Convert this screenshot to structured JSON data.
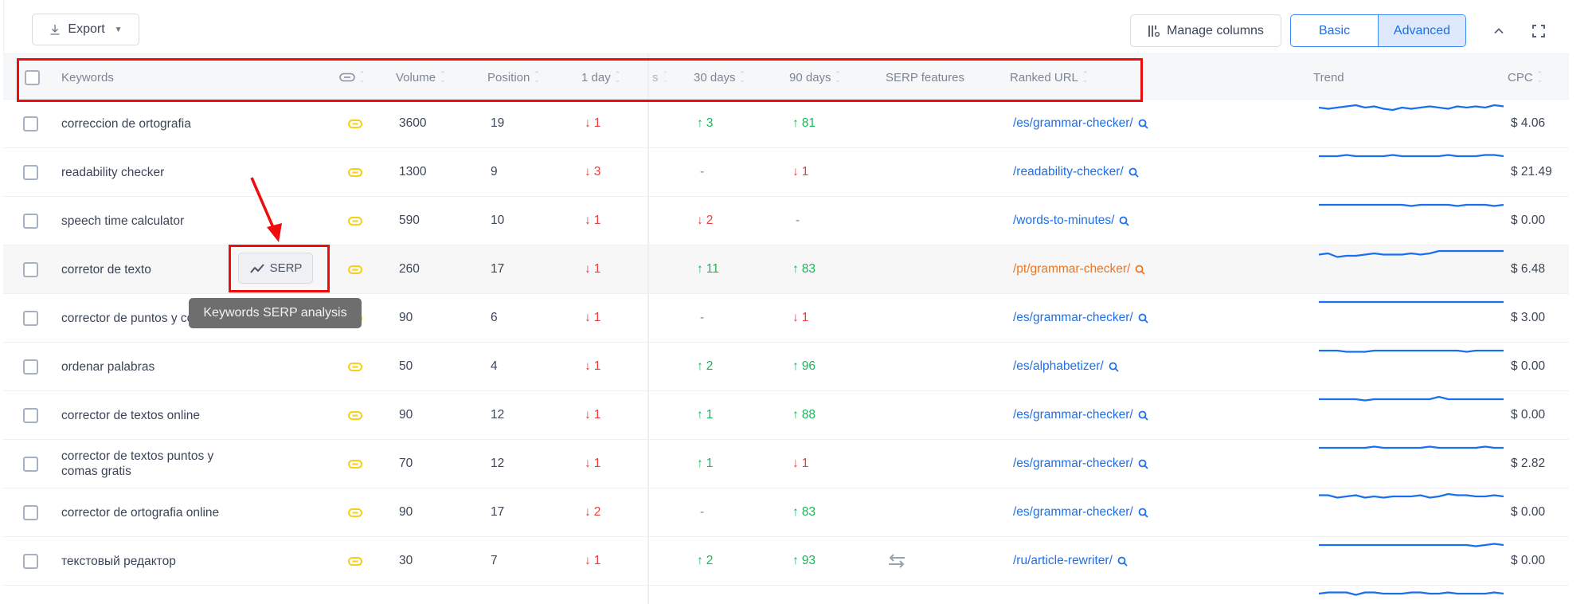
{
  "toolbar": {
    "export_label": "Export",
    "manage_columns_label": "Manage columns",
    "view_modes": [
      {
        "label": "Basic",
        "active": false
      },
      {
        "label": "Advanced",
        "active": true
      }
    ]
  },
  "table": {
    "headers": {
      "keywords": "Keywords",
      "volume": "Volume",
      "position": "Position",
      "day1": "1 day",
      "day7_partial": "s",
      "day30": "30 days",
      "day90": "90 days",
      "serp_features": "SERP features",
      "ranked_url": "Ranked URL",
      "trend": "Trend",
      "cpc": "CPC"
    },
    "rows": [
      {
        "keyword": "correccion de ortografia",
        "volume": "3600",
        "position": "19",
        "d1": {
          "dir": "down",
          "val": "1"
        },
        "d30": {
          "dir": "up",
          "val": "3"
        },
        "d90": {
          "dir": "up",
          "val": "81"
        },
        "serp": "",
        "url": "/es/grammar-checker/",
        "cpc": "$ 4.06",
        "trend": [
          5,
          4,
          5,
          6,
          7,
          5,
          6,
          4,
          3,
          5,
          4,
          5,
          6,
          5,
          4,
          6,
          5,
          6,
          5,
          7,
          6
        ]
      },
      {
        "keyword": "readability checker",
        "volume": "1300",
        "position": "9",
        "d1": {
          "dir": "down",
          "val": "3"
        },
        "d30": {
          "dir": "none",
          "val": "-"
        },
        "d90": {
          "dir": "down",
          "val": "1"
        },
        "serp": "",
        "url": "/readability-checker/",
        "cpc": "$ 21.49",
        "trend": [
          5,
          5,
          5,
          6,
          5,
          5,
          5,
          5,
          6,
          5,
          5,
          5,
          5,
          5,
          6,
          5,
          5,
          5,
          6,
          6,
          5
        ]
      },
      {
        "keyword": "speech time calculator",
        "volume": "590",
        "position": "10",
        "d1": {
          "dir": "down",
          "val": "1"
        },
        "d30": {
          "dir": "down",
          "val": "2"
        },
        "d90": {
          "dir": "none",
          "val": "-"
        },
        "serp": "",
        "url": "/words-to-minutes/",
        "cpc": "$ 0.00",
        "trend": [
          5,
          5,
          5,
          5,
          5,
          5,
          5,
          5,
          5,
          5,
          4,
          5,
          5,
          5,
          5,
          4,
          5,
          5,
          5,
          4,
          5
        ]
      },
      {
        "keyword": "corretor de texto",
        "volume": "260",
        "position": "17",
        "d1": {
          "dir": "down",
          "val": "1"
        },
        "d30": {
          "dir": "up",
          "val": "11"
        },
        "d90": {
          "dir": "up",
          "val": "83"
        },
        "serp": "",
        "url": "/pt/grammar-checker/",
        "url_highlight": true,
        "cpc": "$ 6.48",
        "trend": [
          4,
          5,
          2,
          3,
          3,
          4,
          5,
          4,
          4,
          4,
          5,
          4,
          5,
          7,
          7,
          7,
          7,
          7,
          7,
          7,
          7
        ]
      },
      {
        "keyword": "corrector de puntos y comas",
        "volume": "90",
        "position": "6",
        "d1": {
          "dir": "down",
          "val": "1"
        },
        "d30": {
          "dir": "none",
          "val": "-"
        },
        "d90": {
          "dir": "down",
          "val": "1"
        },
        "serp": "",
        "url": "/es/grammar-checker/",
        "cpc": "$ 3.00",
        "trend": [
          5,
          5,
          5,
          5,
          5,
          5,
          5,
          5,
          5,
          5,
          5,
          5,
          5,
          5,
          5,
          5,
          5,
          5,
          5,
          5,
          5
        ]
      },
      {
        "keyword": "ordenar palabras",
        "volume": "50",
        "position": "4",
        "d1": {
          "dir": "down",
          "val": "1"
        },
        "d30": {
          "dir": "up",
          "val": "2"
        },
        "d90": {
          "dir": "up",
          "val": "96"
        },
        "serp": "",
        "url": "/es/alphabetizer/",
        "cpc": "$ 0.00",
        "trend": [
          5,
          5,
          5,
          4,
          4,
          4,
          5,
          5,
          5,
          5,
          5,
          5,
          5,
          5,
          5,
          5,
          4,
          5,
          5,
          5,
          5
        ]
      },
      {
        "keyword": "corrector de textos online",
        "volume": "90",
        "position": "12",
        "d1": {
          "dir": "down",
          "val": "1"
        },
        "d30": {
          "dir": "up",
          "val": "1"
        },
        "d90": {
          "dir": "up",
          "val": "88"
        },
        "serp": "",
        "url": "/es/grammar-checker/",
        "cpc": "$ 0.00",
        "trend": [
          5,
          5,
          5,
          5,
          5,
          4,
          5,
          5,
          5,
          5,
          5,
          5,
          5,
          7,
          5,
          5,
          5,
          5,
          5,
          5,
          5
        ]
      },
      {
        "keyword": "corrector de textos puntos y comas gratis",
        "volume": "70",
        "position": "12",
        "d1": {
          "dir": "down",
          "val": "1"
        },
        "d30": {
          "dir": "up",
          "val": "1"
        },
        "d90": {
          "dir": "down",
          "val": "1"
        },
        "serp": "",
        "url": "/es/grammar-checker/",
        "cpc": "$ 2.82",
        "trend": [
          5,
          5,
          5,
          5,
          5,
          5,
          6,
          5,
          5,
          5,
          5,
          5,
          6,
          5,
          5,
          5,
          5,
          5,
          6,
          5,
          5
        ]
      },
      {
        "keyword": "corrector de ortografia online",
        "volume": "90",
        "position": "17",
        "d1": {
          "dir": "down",
          "val": "2"
        },
        "d30": {
          "dir": "none",
          "val": "-"
        },
        "d90": {
          "dir": "up",
          "val": "83"
        },
        "serp": "",
        "url": "/es/grammar-checker/",
        "cpc": "$ 0.00",
        "trend": [
          6,
          6,
          4,
          5,
          6,
          4,
          5,
          4,
          5,
          5,
          5,
          6,
          4,
          5,
          7,
          6,
          6,
          5,
          5,
          6,
          5
        ]
      },
      {
        "keyword": "текстовый редактор",
        "volume": "30",
        "position": "7",
        "d1": {
          "dir": "down",
          "val": "1"
        },
        "d30": {
          "dir": "up",
          "val": "2"
        },
        "d90": {
          "dir": "up",
          "val": "93"
        },
        "serp": "swap",
        "url": "/ru/article-rewriter/",
        "cpc": "$ 0.00",
        "trend": [
          5,
          5,
          5,
          5,
          5,
          5,
          5,
          5,
          5,
          5,
          5,
          5,
          5,
          5,
          5,
          5,
          5,
          4,
          5,
          6,
          5
        ]
      },
      {
        "keyword": "",
        "volume": "",
        "position": "",
        "d1": {
          "dir": "none",
          "val": ""
        },
        "d30": {
          "dir": "none",
          "val": ""
        },
        "d90": {
          "dir": "none",
          "val": ""
        },
        "serp": "",
        "url": "",
        "cpc": "",
        "partial": true,
        "trend": [
          5,
          6,
          6,
          6,
          4,
          6,
          6,
          5,
          5,
          5,
          6,
          6,
          5,
          5,
          6,
          5,
          5,
          5,
          5,
          6,
          5
        ]
      }
    ]
  },
  "hover_row_index": 3,
  "serp_button": {
    "label": "SERP"
  },
  "tooltip": {
    "text": "Keywords SERP analysis"
  },
  "colors": {
    "accent": "#1f6fe5",
    "up": "#18b85a",
    "down": "#ef3b3b",
    "url_highlight": "#f0741e",
    "trend_line": "#1a6ff0",
    "annotation": "#ee0c0c",
    "link_icon": "#f6cf16"
  }
}
